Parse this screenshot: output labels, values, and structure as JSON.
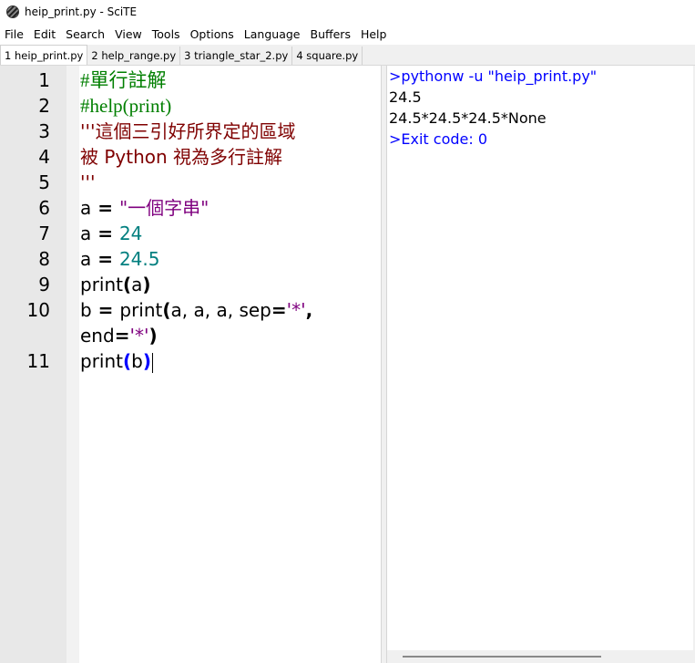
{
  "window": {
    "title": "heip_print.py - SciTE"
  },
  "menu": [
    "File",
    "Edit",
    "Search",
    "View",
    "Tools",
    "Options",
    "Language",
    "Buffers",
    "Help"
  ],
  "tabs": [
    "1 heip_print.py",
    "2 help_range.py",
    "3 triangle_star_2.py",
    "4 square.py"
  ],
  "editor": {
    "line_numbers": [
      "1",
      "2",
      "3",
      "4",
      "5",
      "6",
      "7",
      "8",
      "9",
      "10",
      "",
      "11"
    ],
    "t": {
      "l1": "#單行註解",
      "l2": "#help(print)",
      "l3": "'''這個三引好所界定的區域",
      "l4": "被 Python 視為多行註解",
      "l5": "'''",
      "a": "a",
      "b": "b",
      "eq": " = ",
      "eq_tight": "=",
      "s1": "\"一個字串\"",
      "n24": "24",
      "n245": "24.5",
      "print": "print",
      "lp": "(",
      "rp": ")",
      "args10": "a, a, a, sep",
      "star": "'*'",
      "comma": ",",
      "end": "end"
    }
  },
  "output": {
    "lines": [
      ">pythonw -u \"heip_print.py\"",
      "24.5",
      "24.5*24.5*24.5*None",
      ">Exit code: 0"
    ]
  },
  "colors": {
    "comment": "#007f00",
    "docstring": "#7f0000",
    "string": "#7f007f",
    "number": "#007f7f",
    "command": "#0000ff",
    "brace_match": "#0000ff"
  }
}
